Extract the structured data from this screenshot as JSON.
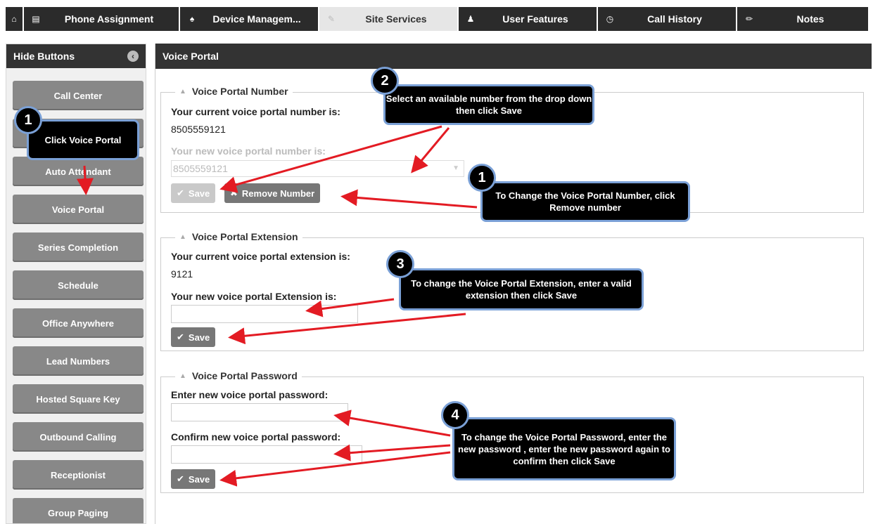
{
  "tabs": [
    {
      "icon": "home-icon",
      "glyph": "⌂",
      "label": ""
    },
    {
      "icon": "list-icon",
      "glyph": "▤",
      "label": "Phone Assignment"
    },
    {
      "icon": "bell-icon",
      "glyph": "♠",
      "label": "Device Managem..."
    },
    {
      "icon": "edit-icon",
      "glyph": "✎",
      "label": "Site Services"
    },
    {
      "icon": "user-icon",
      "glyph": "♟",
      "label": "User Features"
    },
    {
      "icon": "clock-icon",
      "glyph": "◷",
      "label": "Call History"
    },
    {
      "icon": "pencil-icon",
      "glyph": "✏",
      "label": "Notes"
    }
  ],
  "sidebar": {
    "header": "Hide Buttons",
    "items": [
      {
        "label": "Call Center"
      },
      {
        "label": ""
      },
      {
        "label": "Auto Attendant"
      },
      {
        "label": "Voice Portal"
      },
      {
        "label": "Series Completion"
      },
      {
        "label": "Schedule"
      },
      {
        "label": "Office Anywhere"
      },
      {
        "label": "Lead Numbers"
      },
      {
        "label": "Hosted Square Key"
      },
      {
        "label": "Outbound Calling"
      },
      {
        "label": "Receptionist"
      },
      {
        "label": "Group Paging"
      }
    ]
  },
  "main": {
    "title": "Voice Portal",
    "number": {
      "legend": "Voice Portal Number",
      "current_label": "Your current voice portal number is:",
      "current_value": "8505559121",
      "new_label": "Your new voice portal number is:",
      "select_value": "8505559121",
      "save_label": "Save",
      "remove_label": "Remove Number"
    },
    "extension": {
      "legend": "Voice Portal Extension",
      "current_label": "Your current voice portal extension is:",
      "current_value": "9121",
      "new_label": "Your new voice portal Extension is:",
      "input_value": "",
      "save_label": "Save"
    },
    "password": {
      "legend": "Voice Portal Password",
      "new_label": "Enter new voice portal password:",
      "confirm_label": "Confirm new voice portal password:",
      "save_label": "Save"
    }
  },
  "callouts": [
    {
      "badge": "1",
      "text": "Click Voice Portal"
    },
    {
      "badge": "2",
      "text": "Select an available number from the drop down then click Save"
    },
    {
      "badge": "1",
      "text": "To Change the Voice Portal Number,  click Remove number"
    },
    {
      "badge": "3",
      "text": "To change the Voice Portal Extension, enter a valid extension then click Save"
    },
    {
      "badge": "4",
      "text": "To change the Voice Portal Password, enter  the new password , enter the new password  again to confirm then click Save"
    }
  ],
  "colors": {
    "dark": "#2b2b2b",
    "button_gray": "#888888",
    "callout_border": "#7aa0d6",
    "arrow_red": "#e31b23"
  }
}
